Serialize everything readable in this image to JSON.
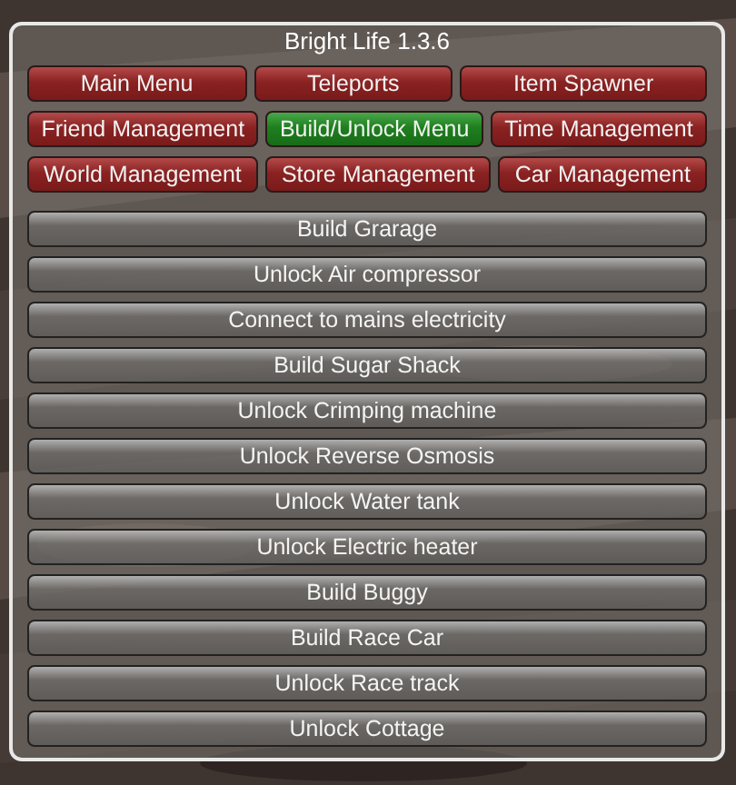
{
  "menu": {
    "title": "Bright Life 1.3.6",
    "tabs": [
      [
        {
          "label": "Main Menu",
          "selected": false
        },
        {
          "label": "Teleports",
          "selected": false
        },
        {
          "label": "Item Spawner",
          "selected": false
        }
      ],
      [
        {
          "label": "Friend Management",
          "selected": false
        },
        {
          "label": "Build/Unlock Menu",
          "selected": true
        },
        {
          "label": "Time Management",
          "selected": false
        }
      ],
      [
        {
          "label": "World Management",
          "selected": false
        },
        {
          "label": "Store Management",
          "selected": false
        },
        {
          "label": "Car Management",
          "selected": false
        }
      ]
    ],
    "actions": [
      "Build Grarage",
      "Unlock Air compressor",
      "Connect to mains electricity",
      "Build Sugar Shack",
      "Unlock Crimping machine",
      "Unlock Reverse Osmosis",
      "Unlock Water tank",
      "Unlock Electric heater",
      "Build Buggy",
      "Build Race Car",
      "Unlock Race track",
      "Unlock Cottage"
    ]
  }
}
